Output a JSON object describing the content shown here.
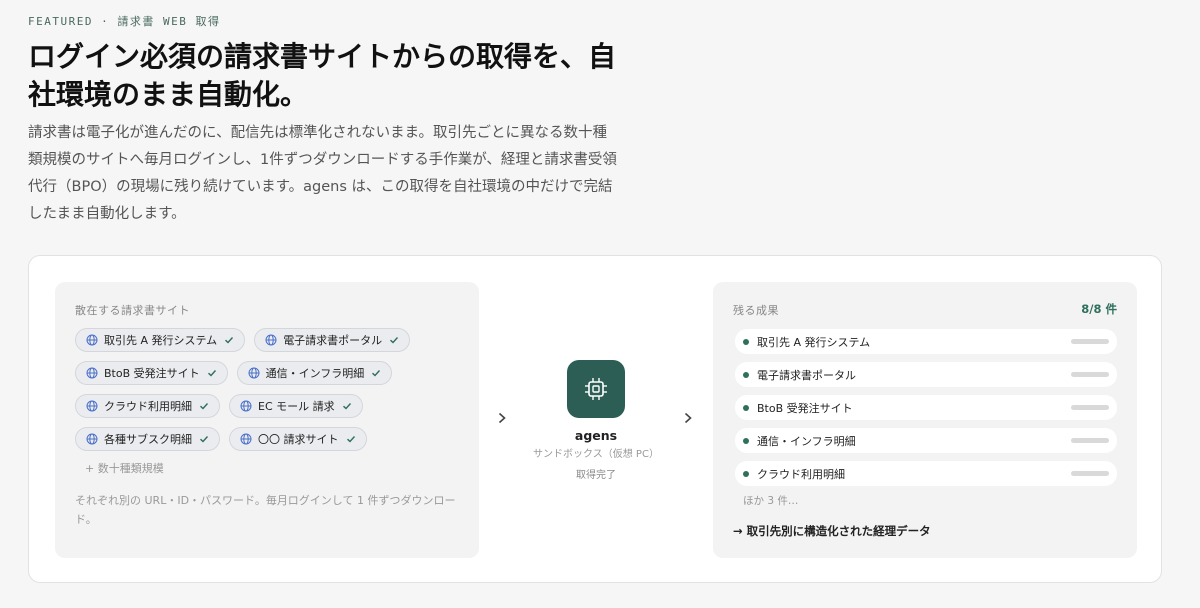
{
  "eyebrow": "FEATURED · 請求書 WEB 取得",
  "headline": "ログイン必須の請求書サイトからの取得を、自社環境のまま自動化。",
  "lead": "請求書は電子化が進んだのに、配信先は標準化されないまま。取引先ごとに異なる数十種類規模のサイトへ毎月ログインし、1件ずつダウンロードする手作業が、経理と請求書受領代行（BPO）の現場に残り続けています。agens は、この取得を自社環境の中だけで完結したまま自動化します。",
  "left_panel": {
    "label": "散在する請求書サイト",
    "sites": [
      {
        "label": "取引先 A 発行システム"
      },
      {
        "label": "電子請求書ポータル"
      },
      {
        "label": "BtoB 受発注サイト"
      },
      {
        "label": "通信・インフラ明細"
      },
      {
        "label": "クラウド利用明細"
      },
      {
        "label": "EC モール 請求"
      },
      {
        "label": "各種サブスク明細"
      },
      {
        "label": "〇〇 請求サイト"
      }
    ],
    "more": "+ 数十種類規模",
    "note": "それぞれ別の URL・ID・パスワード。毎月ログインして 1 件ずつダウンロード。"
  },
  "agent": {
    "name": "agens",
    "sub": "サンドボックス（仮想 PC）",
    "status": "取得完了",
    "icon": "cpu-chip-icon",
    "color": "#2d5e55"
  },
  "right_panel": {
    "label": "残る成果",
    "count": "8/8 件",
    "results": [
      {
        "label": "取引先 A 発行システム"
      },
      {
        "label": "電子請求書ポータル"
      },
      {
        "label": "BtoB 受発注サイト"
      },
      {
        "label": "通信・インフラ明細"
      },
      {
        "label": "クラウド利用明細"
      }
    ],
    "more": "ほか 3 件…",
    "footer": "→ 取引先別に構造化された経理データ"
  },
  "colors": {
    "accent": "#2f6f5c",
    "globe": "#4a6fc9"
  }
}
